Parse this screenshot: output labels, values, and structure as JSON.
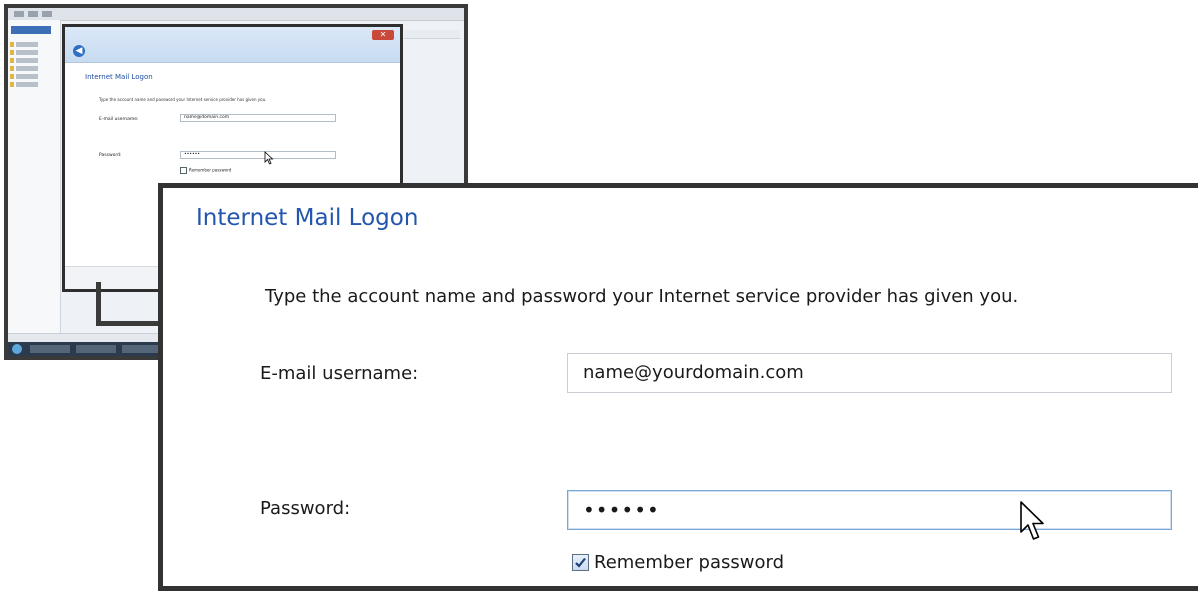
{
  "dialog": {
    "title": "Internet Mail Logon",
    "instruction": "Type the account name and password your Internet service provider has given you.",
    "username_label": "E-mail username:",
    "username_value": "name@yourdomain.com",
    "password_label": "Password:",
    "password_value": "••••••",
    "remember_label": "Remember password",
    "remember_checked": true
  },
  "thumbnail": {
    "title": "Internet Mail Logon",
    "instruction": "Type the account name and password your Internet service provider has given you.",
    "username_label": "E-mail username:",
    "username_value": "name@domain.com",
    "password_label": "Password:",
    "password_value": "••••••",
    "remember_label": "Remember password",
    "close_glyph": "✕",
    "back_glyph": "◀"
  },
  "icons": {
    "checkmark": "✓"
  },
  "colors": {
    "title_blue": "#2356ad",
    "focus_border": "#7aa6d3"
  }
}
